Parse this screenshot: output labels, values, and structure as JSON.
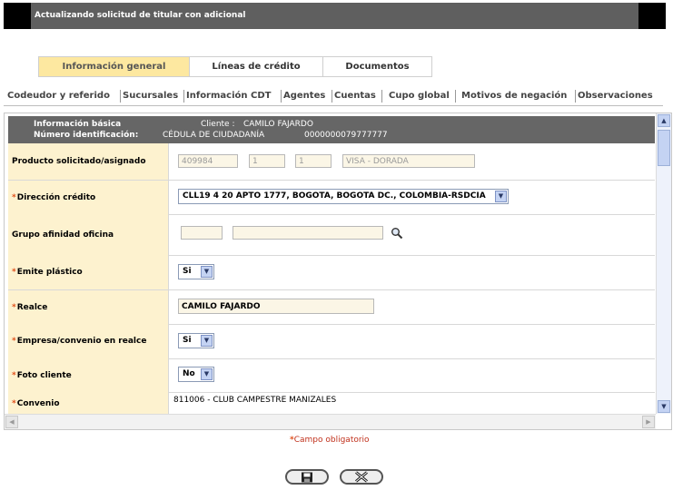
{
  "window": {
    "title": "Actualizando solicitud de titular con adicional"
  },
  "main_tabs": [
    {
      "label": "Información general",
      "active": true
    },
    {
      "label": "Líneas de crédito",
      "active": false
    },
    {
      "label": "Documentos",
      "active": false
    }
  ],
  "sub_tabs": [
    "Codeudor y referido",
    "Sucursales",
    "Información CDT",
    "Agentes",
    "Cuentas",
    "Cupo global",
    "Motivos de negación",
    "Observaciones"
  ],
  "header": {
    "basic_info_label": "Información básica",
    "client_label": "Cliente :",
    "client_name": "CAMILO FAJARDO",
    "id_label": "Número identificación:",
    "id_type": "CÉDULA DE CIUDADANÍA",
    "id_number": "0000000079777777"
  },
  "form": {
    "producto": {
      "label": "Producto solicitado/asignado",
      "code": "409984",
      "field2": "1",
      "field3": "1",
      "name": "VISA - DORADA"
    },
    "direccion": {
      "label": "Dirección crédito",
      "value": "CLL19 4 20 APTO 1777, BOGOTA, BOGOTA DC., COLOMBIA-RSDCIA"
    },
    "grupo": {
      "label": "Grupo afinidad oficina",
      "code": "",
      "name": ""
    },
    "emite_plastico": {
      "label": "Emite plástico",
      "value": "Si"
    },
    "realce": {
      "label": "Realce",
      "value": "CAMILO FAJARDO"
    },
    "empresa_convenio": {
      "label": "Empresa/convenio en realce",
      "value": "Si"
    },
    "foto_cliente": {
      "label": "Foto cliente",
      "value": "No"
    },
    "convenio": {
      "label": "Convenio",
      "value": "811006 - CLUB CAMPESTRE MANIZALES"
    }
  },
  "required_marker": "*",
  "footnote": "Campo obligatorio",
  "colors": {
    "title_bg": "#5f5f5f",
    "label_bg": "#fdf2cf",
    "active_tab": "#fde8a0",
    "required": "#e0501b"
  },
  "icons": {
    "search": "magnifier-icon",
    "save": "floppy-icon",
    "cancel": "x-icon",
    "dropdown": "chevron-down-icon"
  }
}
